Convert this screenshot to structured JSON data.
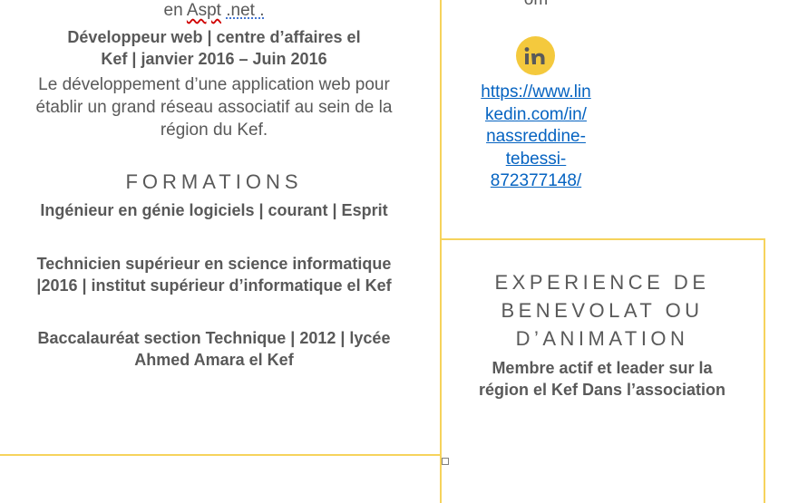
{
  "left_column": {
    "intro_line": {
      "prefix": "en ",
      "word1": "Aspt",
      "space": " ",
      "word2": ".net ."
    },
    "job": {
      "title_line1": "Développeur web | centre d’affaires el",
      "title_line2": "Kef | janvier 2016 – Juin 2016",
      "description": "Le développement d’une application web pour établir un grand réseau associatif au sein de la région du Kef."
    },
    "formations": {
      "heading": "FORMATIONS",
      "items": [
        {
          "line1": "Ingénieur en génie logiciels | courant | Esprit"
        },
        {
          "line1": "Technicien supérieur en science informatique",
          "line2": "|2016 | institut supérieur d’informatique el Kef"
        },
        {
          "line1": "Baccalauréat section Technique | 2012 | lycée",
          "line2": "Ahmed Amara el Kef"
        }
      ]
    }
  },
  "right_column": {
    "top_fragment": "om",
    "linkedin": {
      "icon": "linkedin-icon",
      "url_lines": [
        "https://www.lin",
        "kedin.com/in/",
        "nassreddine-",
        "tebessi-",
        "872377148/"
      ]
    },
    "volunteer": {
      "heading_lines": [
        "EXPERIENCE DE",
        "BENEVOLAT OU",
        "D’ANIMATION"
      ],
      "description_lines": [
        "Membre actif et leader sur la",
        "région el Kef Dans l’association"
      ]
    }
  },
  "colors": {
    "accent": "#f6d35c",
    "text": "#595959",
    "link": "#0563c1",
    "badge": "#f4c93d"
  }
}
